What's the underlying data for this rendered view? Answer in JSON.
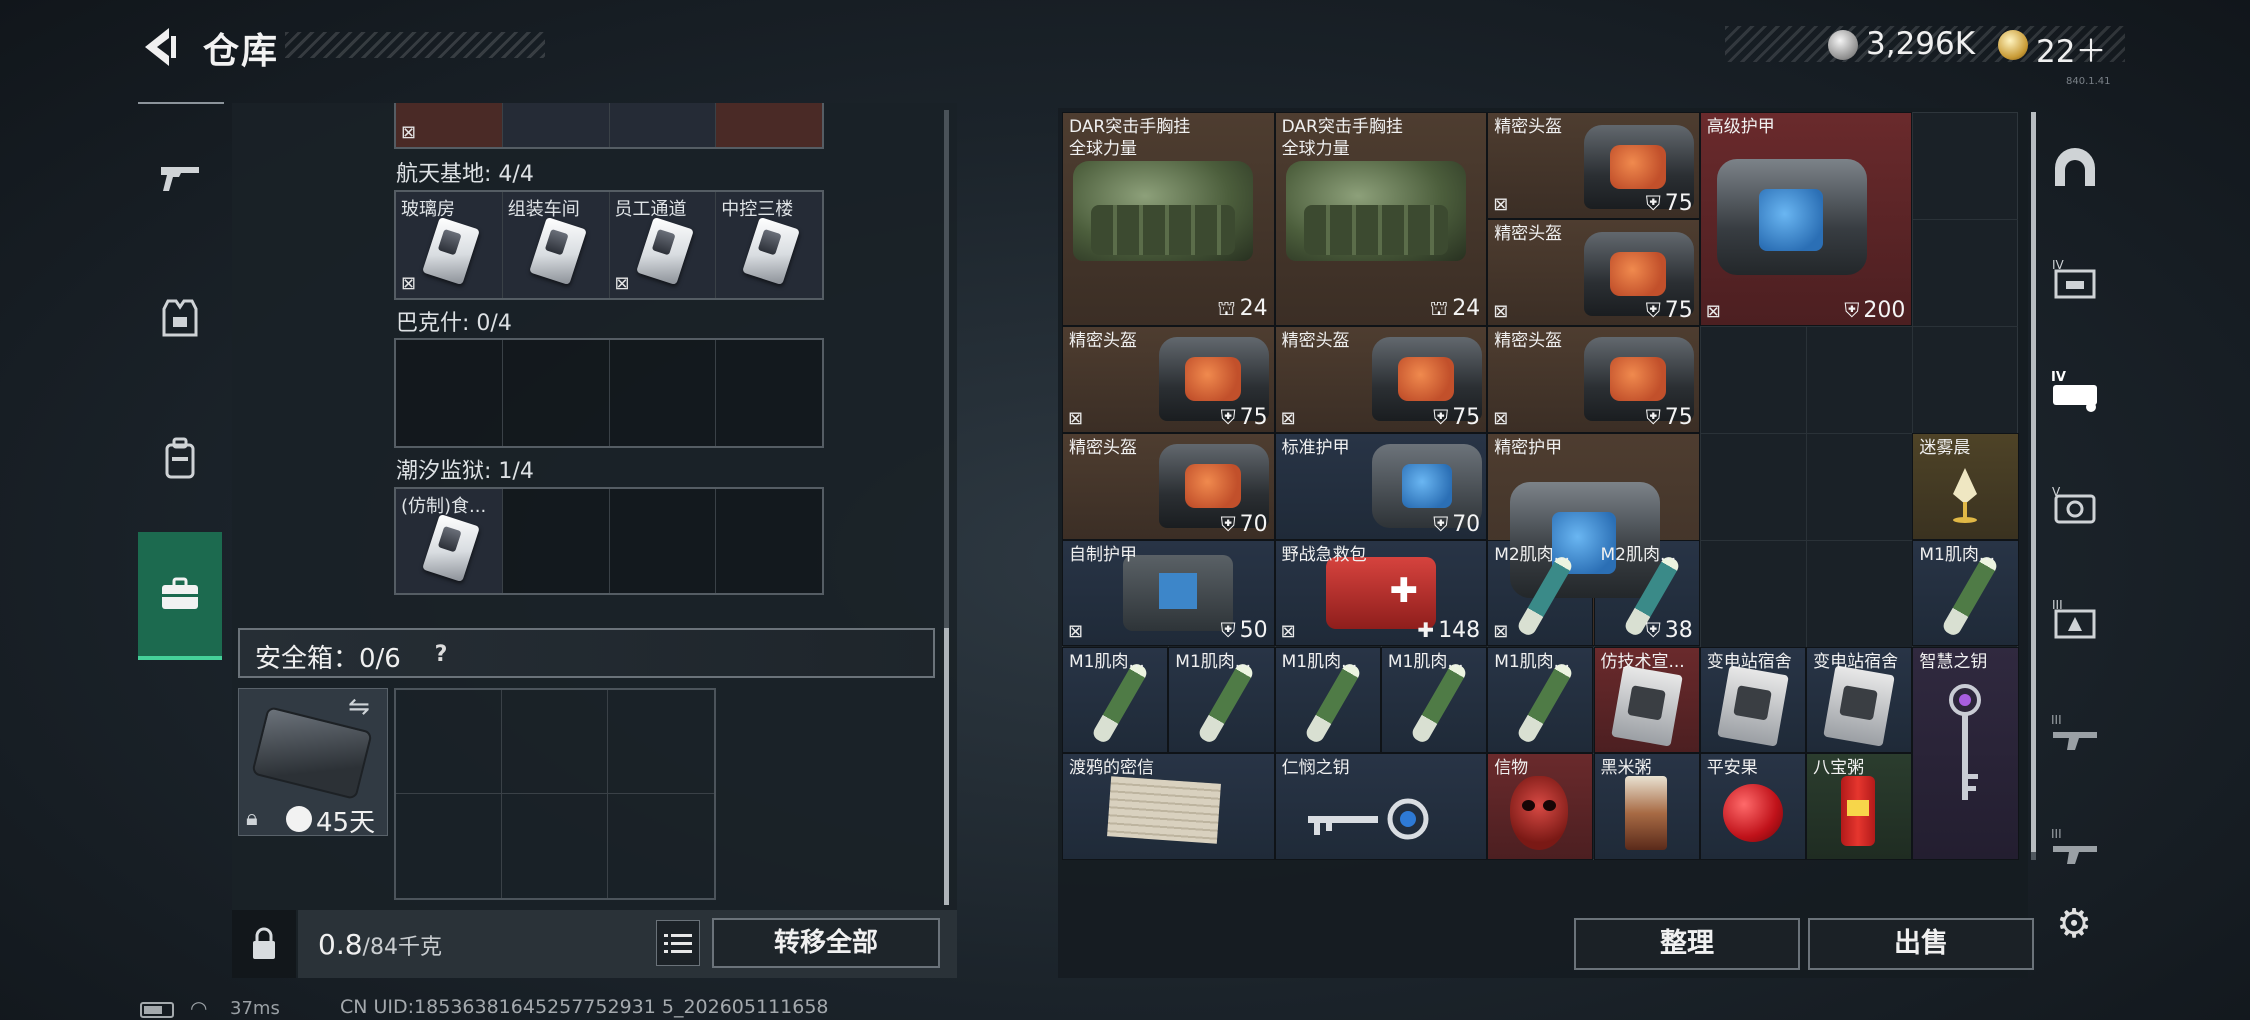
{
  "header": {
    "title": "仓库",
    "currency_silver": "3,296K",
    "currency_gold": "22＋",
    "version": "840.1.41"
  },
  "left_nav": {
    "items": [
      {
        "icon": "gun-icon"
      },
      {
        "icon": "armor-vest-icon"
      },
      {
        "icon": "backpack-icon"
      },
      {
        "icon": "briefcase-icon",
        "active": true
      }
    ]
  },
  "stash": {
    "regions": [
      {
        "name": "航天基地: 4/4",
        "keys": [
          "玻璃房",
          "组装车间",
          "员工通道",
          "中控三楼"
        ]
      },
      {
        "name": "巴克什: 0/4",
        "keys": []
      },
      {
        "name": "潮汐监狱: 1/4",
        "keys": [
          "(仿制)食..."
        ]
      }
    ],
    "safebox": {
      "label": "安全箱：0/6",
      "help": "?",
      "days": "45天"
    },
    "weight_current": "0.8",
    "weight_max": "/84千克",
    "transfer_all": "转移全部"
  },
  "inventory": {
    "items": [
      {
        "name": "DAR突击手胸挂\n全球力量",
        "value": "24",
        "value_icon": "capacity"
      },
      {
        "name": "DAR突击手胸挂\n全球力量",
        "value": "24",
        "value_icon": "capacity"
      },
      {
        "name": "精密头盔",
        "value": "75",
        "value_icon": "shield"
      },
      {
        "name": "精密头盔",
        "value": "75",
        "value_icon": "shield"
      },
      {
        "name": "高级护甲",
        "value": "200",
        "value_icon": "shield"
      },
      {
        "name": "精密头盔",
        "value": "75",
        "value_icon": "shield"
      },
      {
        "name": "精密头盔",
        "value": "75",
        "value_icon": "shield"
      },
      {
        "name": "精密头盔",
        "value": "75",
        "value_icon": "shield"
      },
      {
        "name": "精密头盔",
        "value": "70",
        "value_icon": "shield"
      },
      {
        "name": "标准护甲",
        "value": "70",
        "value_icon": "shield"
      },
      {
        "name": "精密护甲",
        "value": "38",
        "value_icon": "shield"
      },
      {
        "name": "迷雾晨",
        "value": ""
      },
      {
        "name": "自制护甲",
        "value": "50",
        "value_icon": "shield"
      },
      {
        "name": "野战急救包",
        "value": "148",
        "value_icon": "plus"
      },
      {
        "name": "M2肌肉...",
        "value": ""
      },
      {
        "name": "M2肌肉...",
        "value": ""
      },
      {
        "name": "M1肌肉...",
        "value": ""
      },
      {
        "name": "M1肌肉...",
        "value": ""
      },
      {
        "name": "M1肌肉...",
        "value": ""
      },
      {
        "name": "M1肌肉...",
        "value": ""
      },
      {
        "name": "M1肌肉...",
        "value": ""
      },
      {
        "name": "M1肌肉...",
        "value": ""
      },
      {
        "name": "仿技术宣...",
        "value": ""
      },
      {
        "name": "变电站宿舍",
        "value": ""
      },
      {
        "name": "变电站宿舍",
        "value": ""
      },
      {
        "name": "智慧之钥",
        "value": ""
      },
      {
        "name": "渡鸦的密信",
        "value": ""
      },
      {
        "name": "仁悯之钥",
        "value": ""
      },
      {
        "name": "信物",
        "value": ""
      },
      {
        "name": "黑米粥",
        "value": ""
      },
      {
        "name": "平安果",
        "value": ""
      },
      {
        "name": "八宝粥",
        "value": ""
      }
    ],
    "sort_label": "整理",
    "sell_label": "出售"
  },
  "tools": [
    {
      "icon": "dome-icon"
    },
    {
      "icon": "container-iv-icon"
    },
    {
      "icon": "vehicle-iv-icon"
    },
    {
      "icon": "camera-v-icon"
    },
    {
      "icon": "container-iii-icon"
    },
    {
      "icon": "rifle-iii-icon"
    },
    {
      "icon": "rifle-iii-alt-icon"
    }
  ],
  "status": {
    "ping": "37ms",
    "uid": "CN UID:18536381645257752931 5_202605111658"
  }
}
